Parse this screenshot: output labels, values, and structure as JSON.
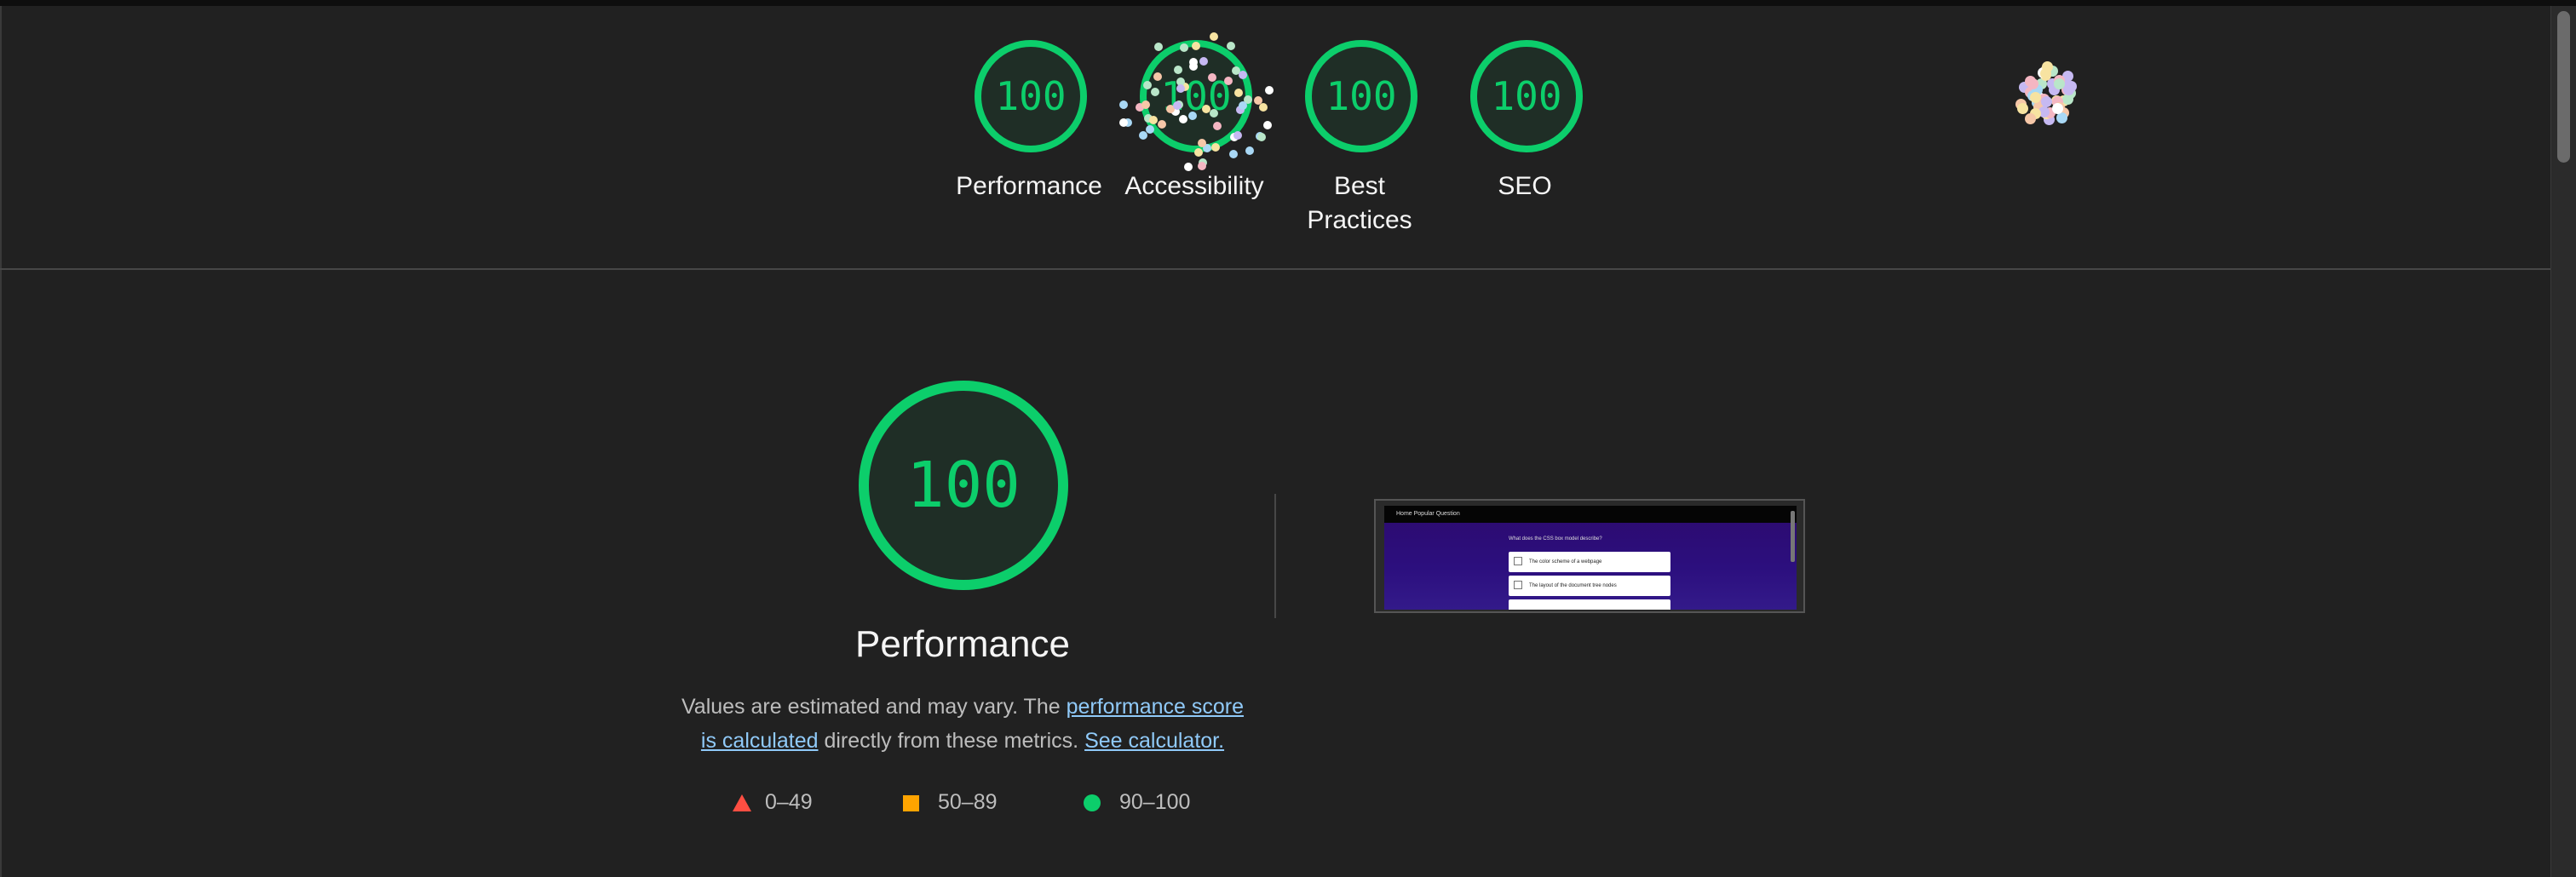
{
  "header": {
    "gauges": [
      {
        "label": "Performance",
        "score": "100"
      },
      {
        "label": "Accessibility",
        "score": "100"
      },
      {
        "label": "Best Practices",
        "score": "100"
      },
      {
        "label": "SEO",
        "score": "100"
      }
    ]
  },
  "performance": {
    "score": "100",
    "title": "Performance",
    "description_prefix": "Values are estimated and may vary. The ",
    "score_link": "performance score is calculated",
    "description_middle": " directly from these metrics. ",
    "calculator_link": "See calculator."
  },
  "legend": {
    "fail": "0–49",
    "average": "50–89",
    "pass": "90–100"
  },
  "thumbnail": {
    "nav_text": "Home    Popular Question",
    "question": "What does the CSS box model describe?",
    "options": [
      "The color scheme of a webpage",
      "The layout of the document tree nodes"
    ]
  },
  "colors": {
    "pass": "#0cce6b",
    "average": "#ffa400",
    "fail": "#ff4e42",
    "link": "#90caf9",
    "background": "#212121"
  }
}
